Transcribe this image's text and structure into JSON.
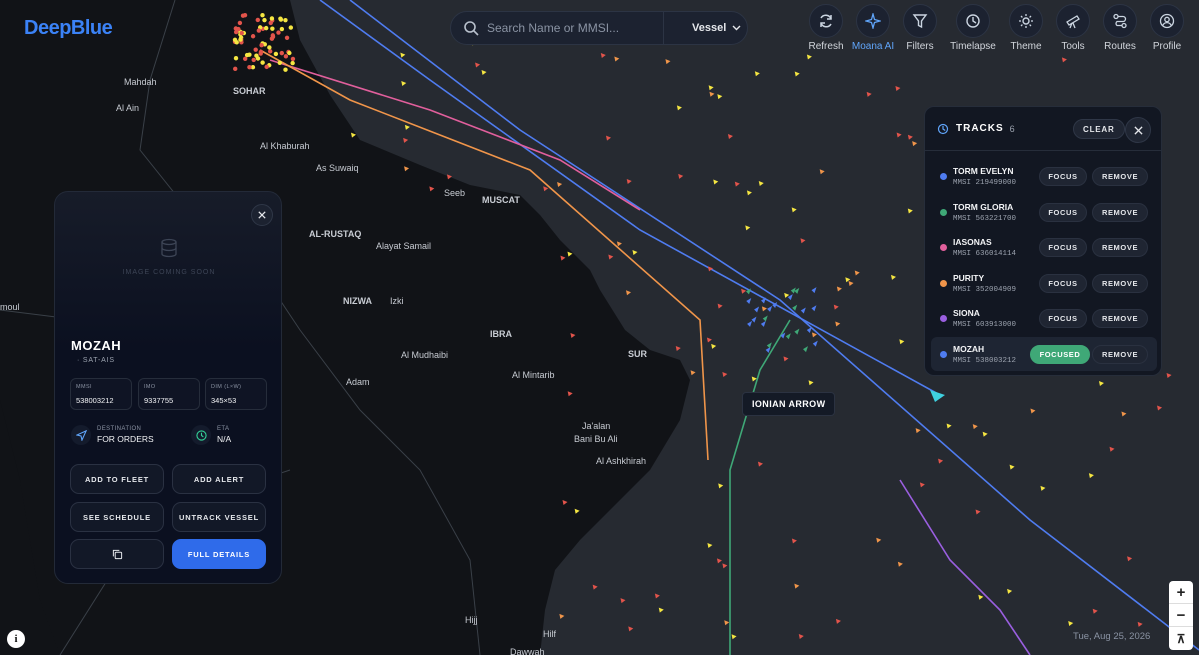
{
  "brand": {
    "logo": "DeepBlue"
  },
  "search": {
    "placeholder": "Search Name or MMSI...",
    "type_value": "Vessel"
  },
  "toolbar": [
    {
      "label": "Refresh",
      "icon": "refresh-icon"
    },
    {
      "label": "Moana AI",
      "icon": "sparkle-icon",
      "active": true
    },
    {
      "label": "Filters",
      "icon": "filter-icon"
    },
    {
      "label": "Timelapse",
      "icon": "history-icon"
    },
    {
      "label": "Theme",
      "icon": "sun-icon"
    },
    {
      "label": "Tools",
      "icon": "telescope-icon"
    },
    {
      "label": "Routes",
      "icon": "route-icon"
    },
    {
      "label": "Profile",
      "icon": "user-icon"
    }
  ],
  "tracks": {
    "title": "TRACKS",
    "count": "6",
    "clear_label": "CLEAR",
    "focus_label": "FOCUS",
    "focused_label": "FOCUSED",
    "remove_label": "REMOVE",
    "items": [
      {
        "name": "TORM EVELYN",
        "mmsi": "MMSI 219499000",
        "color": "#4f7cf0",
        "focused": false
      },
      {
        "name": "TORM GLORIA",
        "mmsi": "MMSI 563221700",
        "color": "#3fa877",
        "focused": false
      },
      {
        "name": "IASONAS",
        "mmsi": "MMSI 636014114",
        "color": "#e15f9c",
        "focused": false
      },
      {
        "name": "PURITY",
        "mmsi": "MMSI 352004909",
        "color": "#f0954a",
        "focused": false
      },
      {
        "name": "SIONA",
        "mmsi": "MMSI 603913000",
        "color": "#9a5fe0",
        "focused": false
      },
      {
        "name": "MOZAH",
        "mmsi": "MMSI 538003212",
        "color": "#4f7cf0",
        "focused": true
      }
    ]
  },
  "vessel": {
    "image_placeholder": "IMAGE COMING SOON",
    "name": "MOZAH",
    "source": "· SAT-AIS",
    "mmsi_label": "MMSI",
    "mmsi": "538003212",
    "imo_label": "IMO",
    "imo": "9337755",
    "dim_label": "DIM (L×W)",
    "dim": "345×53",
    "destination_label": "DESTINATION",
    "destination": "FOR ORDERS",
    "eta_label": "ETA",
    "eta": "N/A",
    "buttons": {
      "add_fleet": "ADD TO FLEET",
      "add_alert": "ADD ALERT",
      "schedule": "SEE SCHEDULE",
      "untrack": "UNTRACK VESSEL",
      "full_details": "FULL DETAILS"
    }
  },
  "map": {
    "hover_label": "IONIAN ARROW",
    "date": "Tue, Aug 25, 2026",
    "zoom_in": "+",
    "zoom_out": "−",
    "compass": "⊼",
    "places": [
      {
        "name": "Mahdah",
        "bold": false
      },
      {
        "name": "Al Ain",
        "bold": false
      },
      {
        "name": "SOHAR",
        "bold": true
      },
      {
        "name": "Al Khaburah",
        "bold": false
      },
      {
        "name": "As Suwaiq",
        "bold": false
      },
      {
        "name": "Seeb",
        "bold": false
      },
      {
        "name": "MUSCAT",
        "bold": true
      },
      {
        "name": "AL-RUSTAQ",
        "bold": true
      },
      {
        "name": "Alayat Samail",
        "bold": false
      },
      {
        "name": "NIZWA",
        "bold": true
      },
      {
        "name": "Izki",
        "bold": false
      },
      {
        "name": "IBRA",
        "bold": true
      },
      {
        "name": "Al Mudhaibi",
        "bold": false
      },
      {
        "name": "SUR",
        "bold": true
      },
      {
        "name": "Adam",
        "bold": false
      },
      {
        "name": "Al Mintarib",
        "bold": false
      },
      {
        "name": "Ja'alan",
        "bold": false
      },
      {
        "name": "Bani Bu Ali",
        "bold": false
      },
      {
        "name": "Al Ashkhirah",
        "bold": false
      },
      {
        "name": "moul",
        "bold": false
      },
      {
        "name": "Hijj",
        "bold": false
      },
      {
        "name": "Hilf",
        "bold": false
      },
      {
        "name": "Dawwah",
        "bold": false
      }
    ]
  }
}
